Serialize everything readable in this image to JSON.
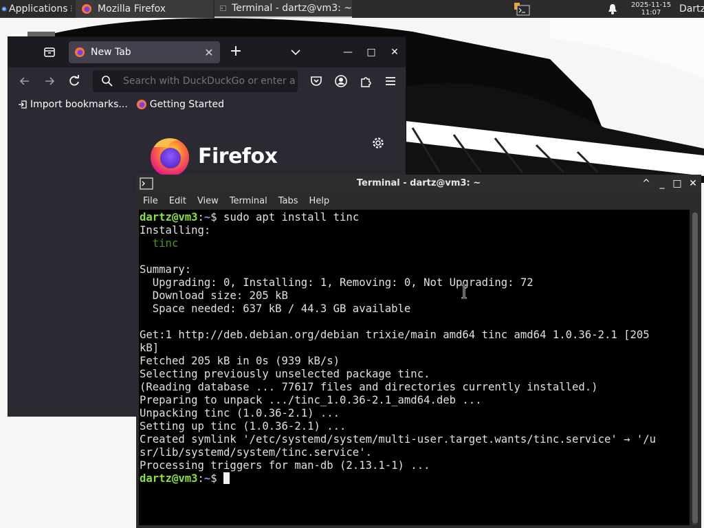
{
  "panel": {
    "applications_label": "Applications",
    "tasks": [
      {
        "label": "Mozilla Firefox",
        "icon": "firefox-icon"
      },
      {
        "label": "Terminal - dartz@vm3: ~",
        "icon": "terminal-icon"
      }
    ],
    "clock": {
      "date": "2025-11-15",
      "time": "11:07"
    },
    "user": "Dartz"
  },
  "firefox": {
    "tab_title": "New Tab",
    "search_placeholder": "Search with DuckDuckGo or enter a",
    "bookmarks": [
      {
        "label": "Import bookmarks...",
        "icon": "import-icon"
      },
      {
        "label": "Getting Started",
        "icon": "firefox-icon"
      }
    ],
    "wordmark": "Firefox",
    "colors": {
      "chrome": "#1c1b22",
      "content": "#2b2a33",
      "tab": "#42414d"
    }
  },
  "terminal": {
    "title": "Terminal - dartz@vm3: ~",
    "menu": [
      "File",
      "Edit",
      "View",
      "Terminal",
      "Tabs",
      "Help"
    ],
    "prompt_user": "dartz@vm3",
    "prompt_path": "~",
    "prompt_sep": ":",
    "prompt_symbol": "$",
    "command": " sudo apt install tinc",
    "output_installing": "Installing:",
    "output_package": "  tinc",
    "output_lines": [
      "",
      "Summary:",
      "  Upgrading: 0, Installing: 1, Removing: 0, Not Upgrading: 72",
      "  Download size: 205 kB",
      "  Space needed: 637 kB / 44.3 GB available",
      "",
      "Get:1 http://deb.debian.org/debian trixie/main amd64 tinc amd64 1.0.36-2.1 [205",
      "kB]",
      "Fetched 205 kB in 0s (939 kB/s)",
      "Selecting previously unselected package tinc.",
      "(Reading database ... 77617 files and directories currently installed.)",
      "Preparing to unpack .../tinc_1.0.36-2.1_amd64.deb ...",
      "Unpacking tinc (1.0.36-2.1) ...",
      "Setting up tinc (1.0.36-2.1) ...",
      "Created symlink '/etc/systemd/system/multi-user.target.wants/tinc.service' → '/u",
      "sr/lib/systemd/system/tinc.service'.",
      "Processing triggers for man-db (2.13.1-1) ..."
    ],
    "colors": {
      "prompt_user": "#8ae234",
      "prompt_path": "#729fcf",
      "package": "#4e9a06",
      "background": "#000000"
    }
  }
}
